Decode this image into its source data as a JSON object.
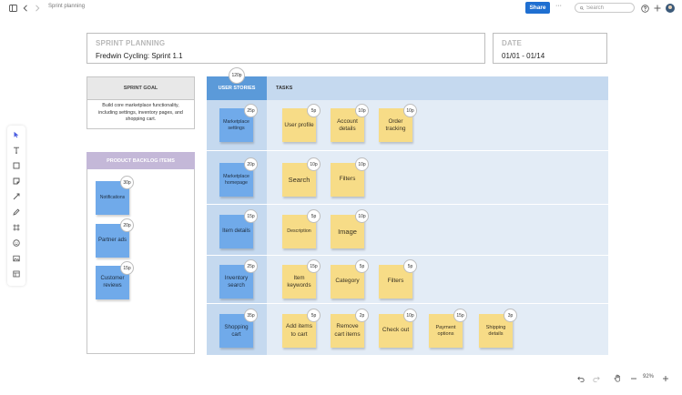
{
  "topbar": {
    "doc_title": "Sprint planning",
    "share_label": "Share",
    "more_label": "···",
    "search_placeholder": "Search"
  },
  "header": {
    "sprint_label": "SPRINT PLANNING",
    "sprint_value": "Fredwin Cycling: Sprint 1.1",
    "date_label": "DATE",
    "date_value": "01/01 - 01/14"
  },
  "goal": {
    "title": "SPRINT GOAL",
    "text": "Build core marketplace functionality, including settings, inventory pages, and shopping cart."
  },
  "backlog": {
    "title": "PRODUCT BACKLOG ITEMS",
    "items": [
      {
        "label": "Notifications",
        "points": "30p"
      },
      {
        "label": "Partner ads",
        "points": "20p"
      },
      {
        "label": "Customer reviews",
        "points": "15p"
      }
    ]
  },
  "board": {
    "stories_label": "USER STORIES",
    "stories_total": "120p",
    "tasks_label": "TASKS",
    "rows": [
      {
        "story": "Marketplace settings",
        "points": "25p",
        "tasks": [
          {
            "label": "User profile",
            "points": "5p"
          },
          {
            "label": "Account details",
            "points": "10p"
          },
          {
            "label": "Order tracking",
            "points": "10p"
          }
        ]
      },
      {
        "story": "Marketplace homepage",
        "points": "20p",
        "tasks": [
          {
            "label": "Search",
            "points": "10p"
          },
          {
            "label": "Filters",
            "points": "10p"
          }
        ]
      },
      {
        "story": "Item details",
        "points": "15p",
        "tasks": [
          {
            "label": "Description",
            "points": "5p"
          },
          {
            "label": "Image",
            "points": "10p"
          }
        ]
      },
      {
        "story": "Inventory search",
        "points": "25p",
        "tasks": [
          {
            "label": "Item keywords",
            "points": "15p"
          },
          {
            "label": "Category",
            "points": "5p"
          },
          {
            "label": "Filters",
            "points": "5p"
          }
        ]
      },
      {
        "story": "Shopping cart",
        "points": "35p",
        "tasks": [
          {
            "label": "Add items to cart",
            "points": "5p"
          },
          {
            "label": "Remove cart items",
            "points": "2p"
          },
          {
            "label": "Check out",
            "points": "10p"
          },
          {
            "label": "Payment options",
            "points": "15p"
          },
          {
            "label": "Shipping details",
            "points": "3p"
          }
        ]
      }
    ]
  },
  "zoom": {
    "value": "92%"
  },
  "colors": {
    "accent": "#1f6fd1",
    "story_blue": "#70aaea",
    "task_yellow": "#f7dc87",
    "backlog_purple": "#c4b8d8",
    "board_bg": "#e3ecf6"
  }
}
